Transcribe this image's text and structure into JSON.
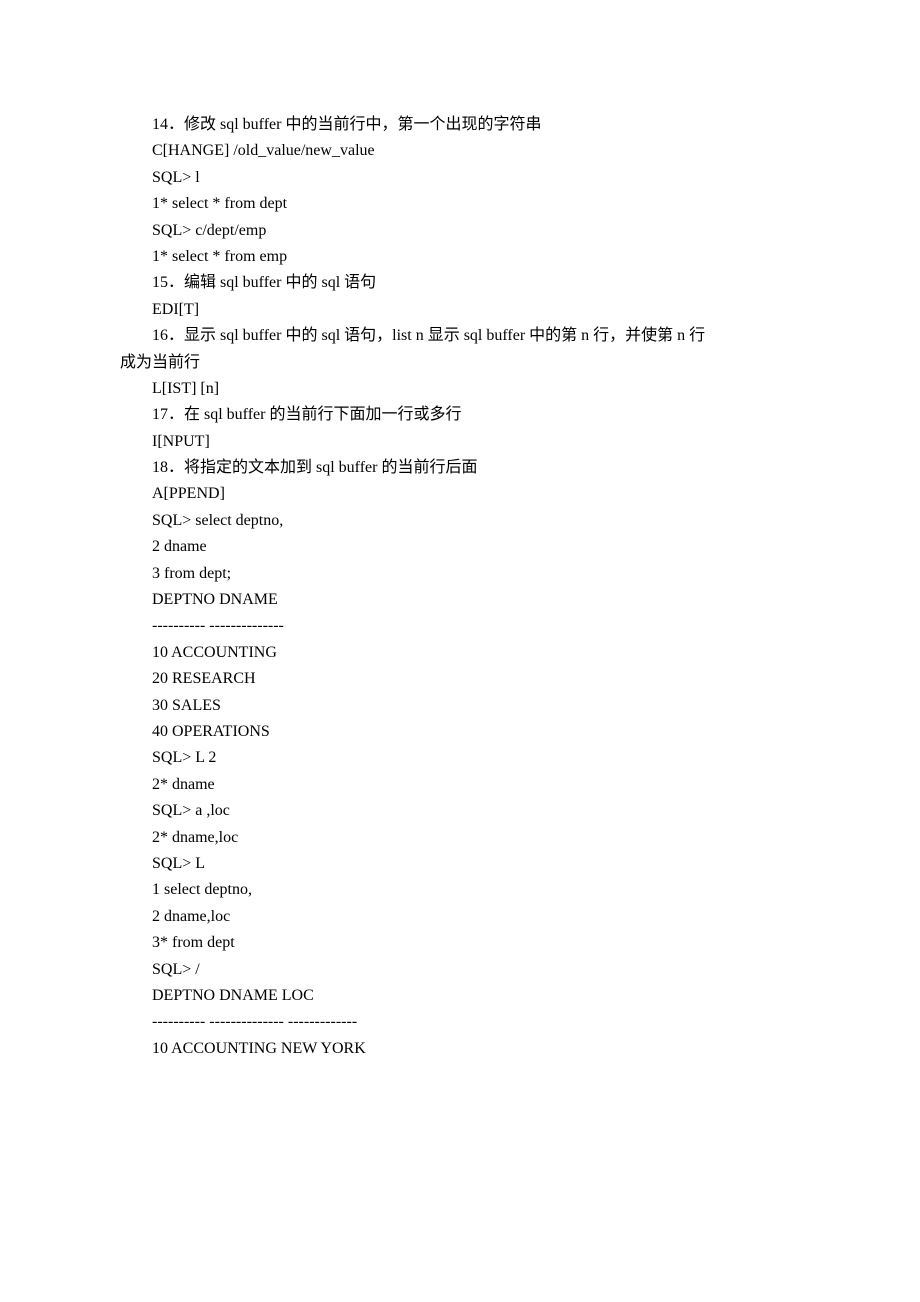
{
  "lines": [
    {
      "text": "14．修改 sql buffer 中的当前行中，第一个出现的字符串",
      "indent": true
    },
    {
      "text": "C[HANGE] /old_value/new_value",
      "indent": true
    },
    {
      "text": "SQL> l",
      "indent": true
    },
    {
      "text": "1* select * from dept",
      "indent": true
    },
    {
      "text": "SQL> c/dept/emp",
      "indent": true
    },
    {
      "text": "1* select * from emp",
      "indent": true
    },
    {
      "text": "15．编辑 sql buffer 中的 sql 语句",
      "indent": true
    },
    {
      "text": "EDI[T]",
      "indent": true
    },
    {
      "text": "16．显示 sql buffer 中的 sql 语句，list n 显示 sql buffer 中的第 n 行，并使第 n 行",
      "indent": true
    },
    {
      "text": "成为当前行",
      "indent": false
    },
    {
      "text": "L[IST] [n]",
      "indent": true
    },
    {
      "text": "17．在 sql buffer 的当前行下面加一行或多行",
      "indent": true
    },
    {
      "text": "I[NPUT]",
      "indent": true
    },
    {
      "text": "18．将指定的文本加到 sql buffer 的当前行后面",
      "indent": true
    },
    {
      "text": "A[PPEND]",
      "indent": true
    },
    {
      "text": "SQL> select deptno,",
      "indent": true
    },
    {
      "text": "2 dname",
      "indent": true
    },
    {
      "text": "3 from dept;",
      "indent": true
    },
    {
      "text": "DEPTNO DNAME",
      "indent": true
    },
    {
      "text": "---------- --------------",
      "indent": true
    },
    {
      "text": "10 ACCOUNTING",
      "indent": true
    },
    {
      "text": "20 RESEARCH",
      "indent": true
    },
    {
      "text": "30 SALES",
      "indent": true
    },
    {
      "text": "40 OPERATIONS",
      "indent": true
    },
    {
      "text": "SQL> L 2",
      "indent": true
    },
    {
      "text": "2* dname",
      "indent": true
    },
    {
      "text": "SQL> a ,loc",
      "indent": true
    },
    {
      "text": "2* dname,loc",
      "indent": true
    },
    {
      "text": "SQL> L",
      "indent": true
    },
    {
      "text": "1 select deptno,",
      "indent": true
    },
    {
      "text": "2 dname,loc",
      "indent": true
    },
    {
      "text": "3* from dept",
      "indent": true
    },
    {
      "text": "SQL> /",
      "indent": true
    },
    {
      "text": "DEPTNO DNAME LOC",
      "indent": true
    },
    {
      "text": "---------- -------------- -------------",
      "indent": true
    },
    {
      "text": "10 ACCOUNTING NEW YORK",
      "indent": true
    }
  ]
}
